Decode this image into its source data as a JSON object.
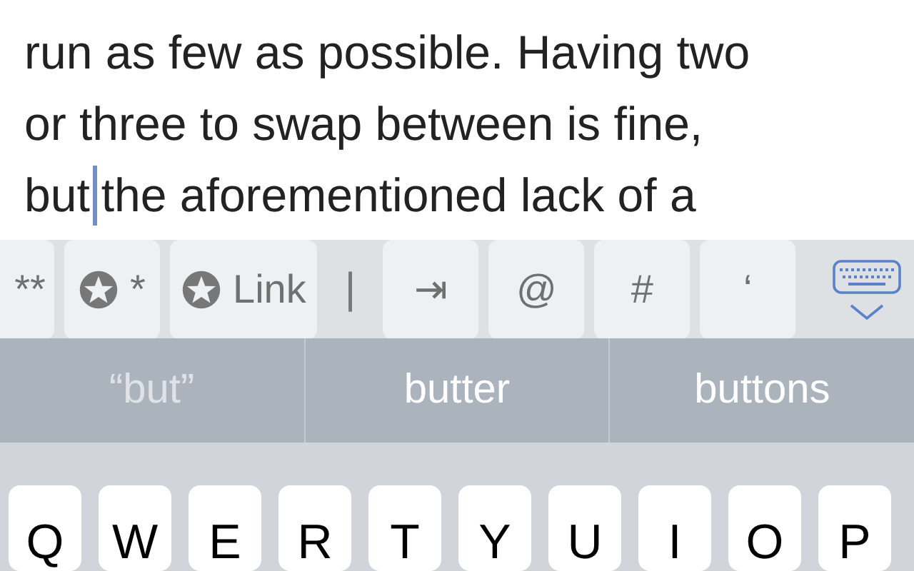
{
  "document": {
    "lines": [
      {
        "text": "run as few as possible. Having two"
      },
      {
        "text": "or three to swap between is fine,"
      },
      {
        "before_caret": "but",
        "after_caret": "the aforementioned lack of a"
      }
    ]
  },
  "toolbar": [
    {
      "kind": "text",
      "label": "**"
    },
    {
      "kind": "star",
      "label": "*"
    },
    {
      "kind": "star",
      "label": "Link"
    },
    {
      "kind": "separator",
      "label": "|"
    },
    {
      "kind": "text",
      "label": "⇥"
    },
    {
      "kind": "text",
      "label": "@"
    },
    {
      "kind": "text",
      "label": "#"
    },
    {
      "kind": "text",
      "label": "‘"
    },
    {
      "kind": "dismiss"
    }
  ],
  "suggestions": [
    {
      "text": "“but”",
      "selected": false
    },
    {
      "text": "butter",
      "selected": false
    },
    {
      "text": "buttons",
      "selected": false
    }
  ],
  "keys": [
    "Q",
    "W",
    "E",
    "R",
    "T",
    "Y",
    "U",
    "I",
    "O",
    "P"
  ]
}
